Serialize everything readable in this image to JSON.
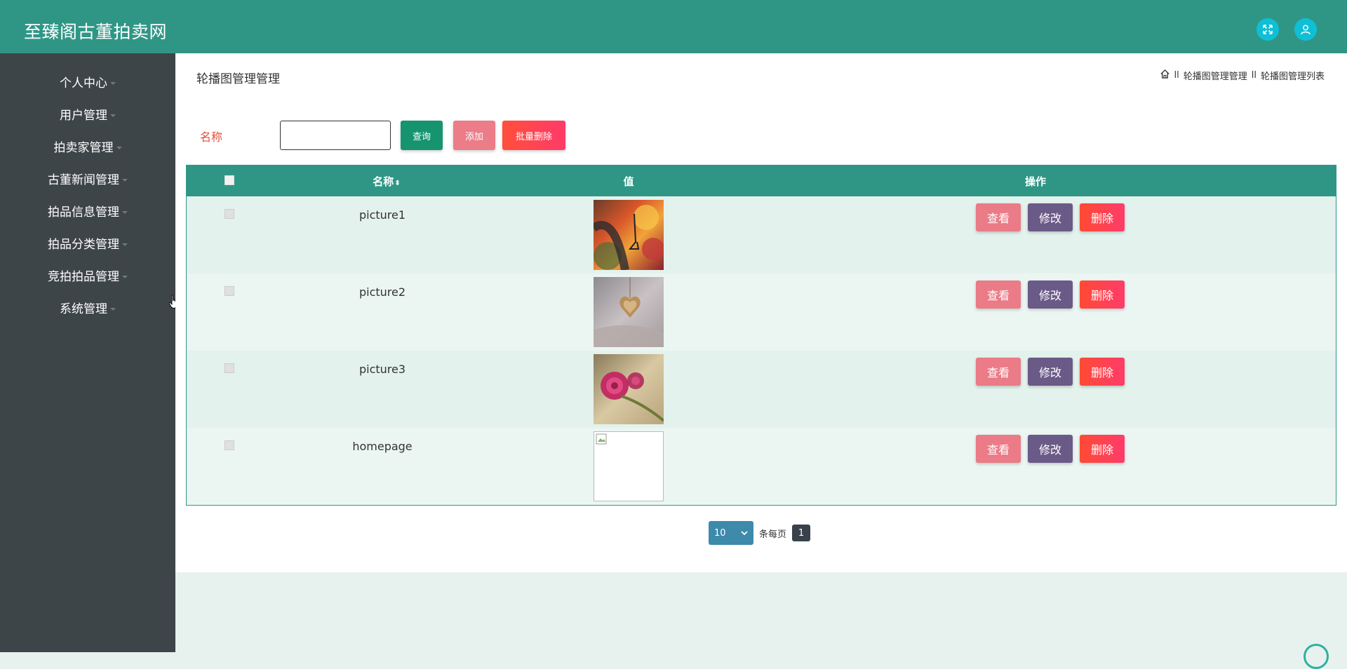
{
  "header": {
    "title": "至臻阁古董拍卖网",
    "icons": [
      "expand-icon",
      "user-icon"
    ],
    "bg_color": "#2f9686"
  },
  "sidebar": {
    "items": [
      {
        "label": "个人中心"
      },
      {
        "label": "用户管理"
      },
      {
        "label": "拍卖家管理"
      },
      {
        "label": "古董新闻管理"
      },
      {
        "label": "拍品信息管理"
      },
      {
        "label": "拍品分类管理"
      },
      {
        "label": "竞拍拍品管理"
      },
      {
        "label": "系统管理"
      }
    ]
  },
  "main": {
    "heading": "轮播图管理管理",
    "breadcrumb": {
      "separator": "ll",
      "items": [
        "轮播图管理管理",
        "轮播图管理列表"
      ]
    },
    "filter": {
      "label": "名称",
      "input_value": "",
      "query_label": "查询",
      "add_label": "添加",
      "batch_delete_label": "批量删除"
    },
    "table": {
      "headers": {
        "name": "名称",
        "value": "值",
        "actions": "操作"
      },
      "rows": [
        {
          "name": "picture1",
          "image": "photo-colorful-bokeh"
        },
        {
          "name": "picture2",
          "image": "photo-heart-pendant"
        },
        {
          "name": "picture3",
          "image": "photo-red-roses"
        },
        {
          "name": "homepage",
          "image": "broken-image"
        }
      ],
      "action_labels": {
        "view": "查看",
        "edit": "修改",
        "delete": "删除"
      }
    },
    "pagination": {
      "page_size": "10",
      "per_page_text": "条每页",
      "current_page": "1"
    }
  },
  "colors": {
    "accent": "#2f9686",
    "sidebar": "#3e4549",
    "view_button": "#ea7b87",
    "edit_button": "#6a5a87",
    "delete_button": "#ff4a34"
  }
}
